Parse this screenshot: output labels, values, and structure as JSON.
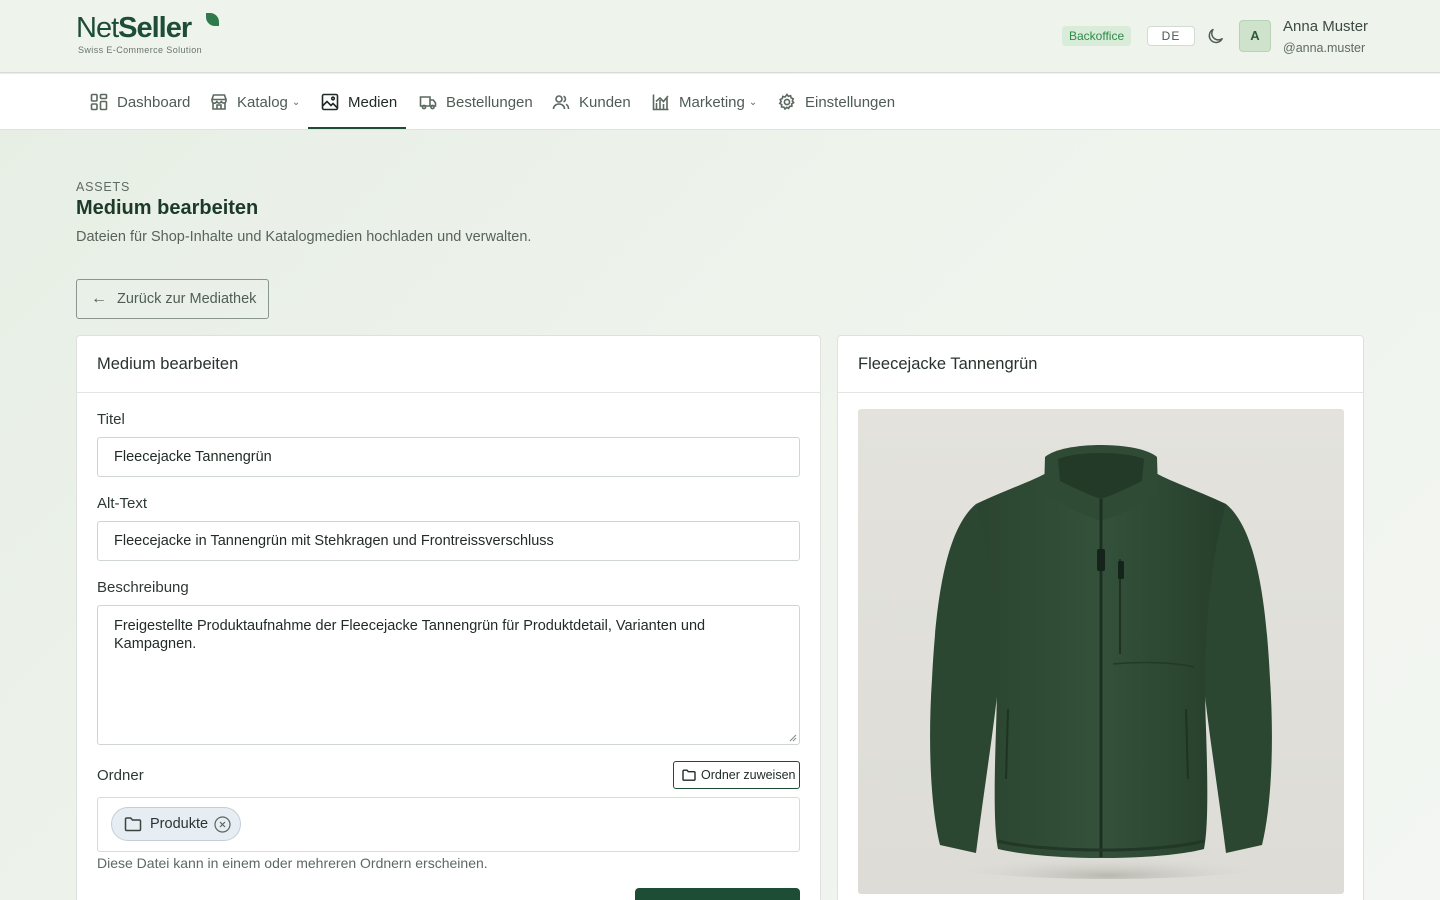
{
  "brand": {
    "name_part1": "Net",
    "name_part2": "Seller",
    "tagline": "Swiss E-Commerce Solution",
    "color": "#1e4d36"
  },
  "header": {
    "badge": "Backoffice",
    "language": "DE",
    "theme_icon": "moon-icon",
    "user": {
      "initial": "A",
      "name": "Anna Muster",
      "handle": "@anna.muster"
    }
  },
  "nav": {
    "items": [
      {
        "label": "Dashboard",
        "icon": "dashboard-icon"
      },
      {
        "label": "Katalog",
        "icon": "store-icon",
        "has_dropdown": true
      },
      {
        "label": "Medien",
        "icon": "image-icon",
        "active": true
      },
      {
        "label": "Bestellungen",
        "icon": "truck-icon"
      },
      {
        "label": "Kunden",
        "icon": "users-icon"
      },
      {
        "label": "Marketing",
        "icon": "chart-icon",
        "has_dropdown": true
      },
      {
        "label": "Einstellungen",
        "icon": "gear-icon"
      }
    ]
  },
  "page": {
    "eyebrow": "ASSETS",
    "title": "Medium bearbeiten",
    "subtitle": "Dateien für Shop-Inhalte und Katalogmedien hochladen und verwalten.",
    "back_label": "Zurück zur Mediathek"
  },
  "form": {
    "card_title": "Medium bearbeiten",
    "title_label": "Titel",
    "title_value": "Fleecejacke Tannengrün",
    "alt_label": "Alt-Text",
    "alt_value": "Fleecejacke in Tannengrün mit Stehkragen und Frontreissverschluss",
    "description_label": "Beschreibung",
    "description_value": "Freigestellte Produktaufnahme der Fleecejacke Tannengrün für Produktdetail, Varianten und Kampagnen.",
    "folder_label": "Ordner",
    "assign_folder_label": "Ordner zuweisen",
    "folders": [
      "Produkte"
    ],
    "folder_hint": "Diese Datei kann in einem oder mehreren Ordnern erscheinen."
  },
  "preview": {
    "card_title": "Fleecejacke Tannengrün",
    "jacket_color": "#2f4a35"
  }
}
